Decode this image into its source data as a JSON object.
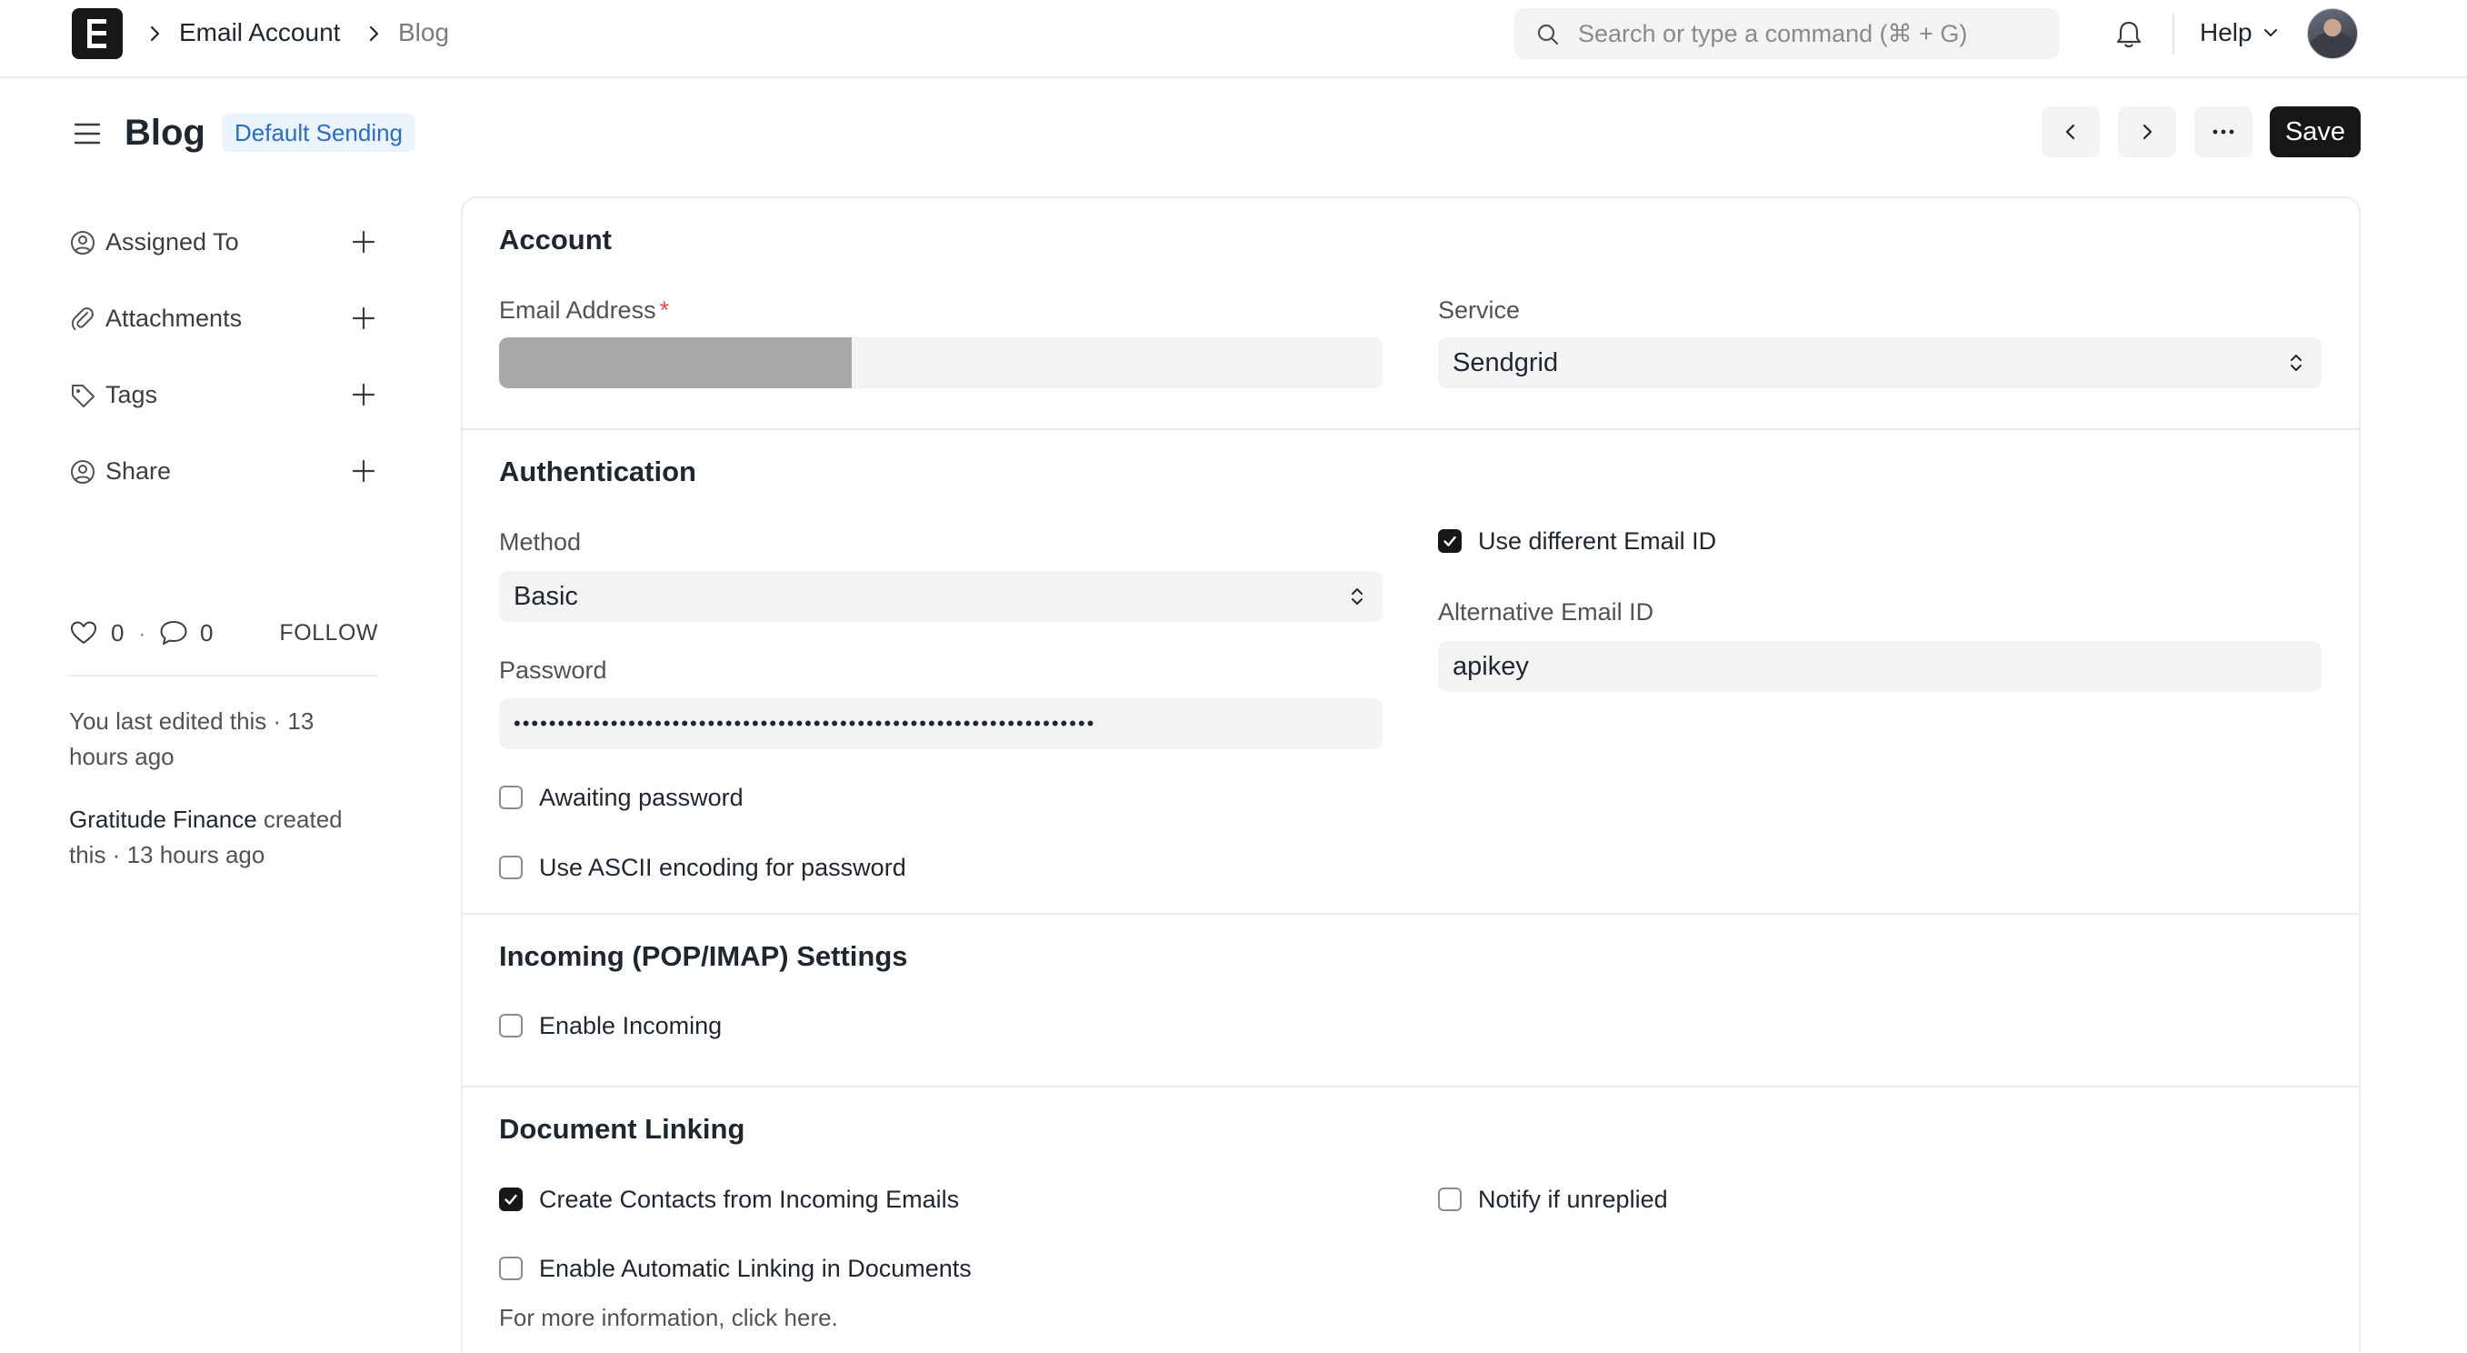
{
  "navbar": {
    "logo_letter": "E",
    "breadcrumbs": [
      "Email Account",
      "Blog"
    ],
    "search_placeholder": "Search or type a command (⌘ + G)",
    "help_label": "Help"
  },
  "page": {
    "title": "Blog",
    "badge": "Default Sending",
    "save_label": "Save"
  },
  "sidebar": {
    "items": [
      {
        "label": "Assigned To",
        "icon": "user-assign-icon"
      },
      {
        "label": "Attachments",
        "icon": "paperclip-icon"
      },
      {
        "label": "Tags",
        "icon": "tag-icon"
      },
      {
        "label": "Share",
        "icon": "share-user-icon"
      }
    ],
    "likes": "0",
    "comments": "0",
    "follow_label": "FOLLOW",
    "activity": [
      {
        "text": "You last edited this · 13 hours ago"
      },
      {
        "actor": "Gratitude Finance",
        "text": " created this · 13 hours ago"
      }
    ]
  },
  "form": {
    "account": {
      "title": "Account",
      "email_label": "Email Address",
      "required_mark": "*",
      "service_label": "Service",
      "service_value": "Sendgrid"
    },
    "authentication": {
      "title": "Authentication",
      "method_label": "Method",
      "method_value": "Basic",
      "password_label": "Password",
      "password_value": "••••••••••••••••••••••••••••••••••••••••••••••••••••••••••••••••••",
      "awaiting_password": {
        "label": "Awaiting password",
        "checked": false
      },
      "ascii_encoding": {
        "label": "Use ASCII encoding for password",
        "checked": false
      },
      "use_different_email": {
        "label": "Use different Email ID",
        "checked": true
      },
      "alt_email_label": "Alternative Email ID",
      "alt_email_value": "apikey"
    },
    "incoming": {
      "title": "Incoming (POP/IMAP) Settings",
      "enable_incoming": {
        "label": "Enable Incoming",
        "checked": false
      }
    },
    "linking": {
      "title": "Document Linking",
      "create_contacts": {
        "label": "Create Contacts from Incoming Emails",
        "checked": true
      },
      "notify_unreplied": {
        "label": "Notify if unreplied",
        "checked": false
      },
      "auto_linking": {
        "label": "Enable Automatic Linking in Documents",
        "checked": false
      },
      "help_text": "For more information, click here."
    }
  },
  "colors": {
    "accent_dark": "#171717",
    "badge_bg": "#ebf4fd",
    "badge_text": "#2c6cc3",
    "control_bg": "#f3f3f3",
    "required": "#e24c4c"
  }
}
